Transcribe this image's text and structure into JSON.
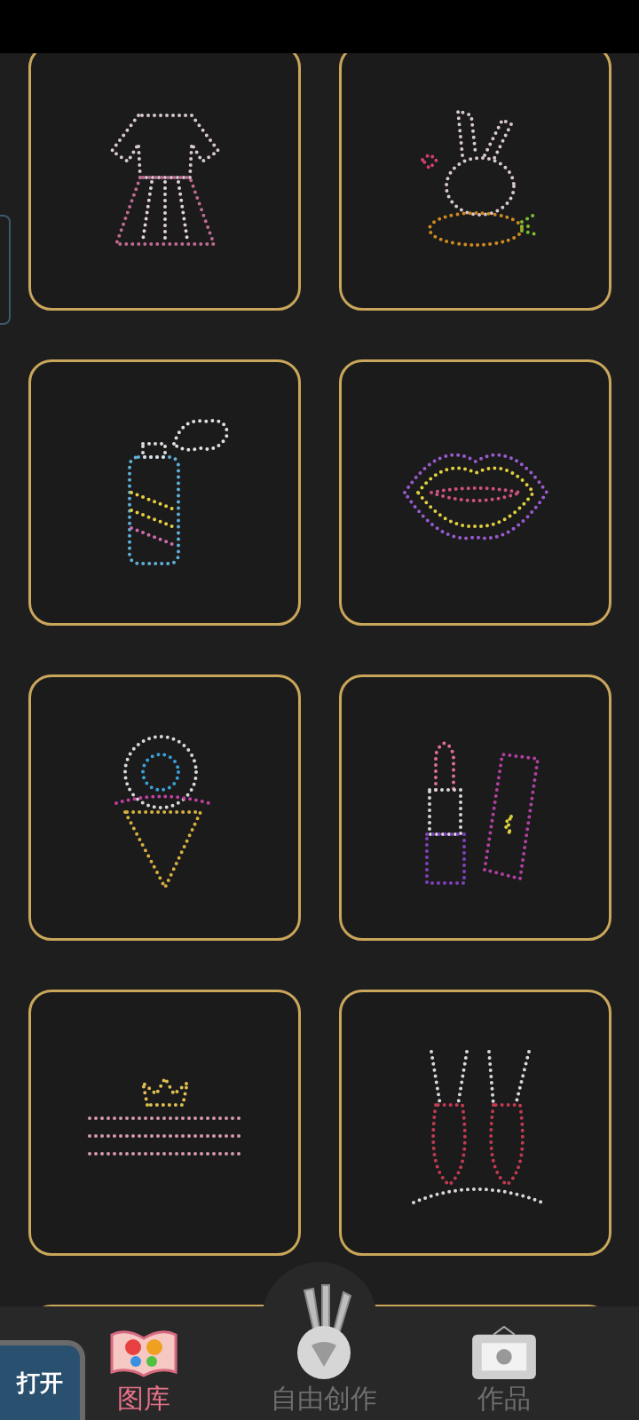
{
  "gallery": [
    {
      "kind": "dress"
    },
    {
      "kind": "rabbit"
    },
    {
      "kind": "spray"
    },
    {
      "kind": "lips"
    },
    {
      "kind": "icecream"
    },
    {
      "kind": "lipstick"
    },
    {
      "kind": "princess"
    },
    {
      "kind": "ballet"
    },
    {
      "kind": "blank"
    },
    {
      "kind": "blank"
    }
  ],
  "tabs": [
    {
      "label": "图库",
      "kind": "book",
      "selected": true
    },
    {
      "label": "自由创作",
      "kind": "brushes",
      "selected": false
    },
    {
      "label": "作品",
      "kind": "frame",
      "selected": false
    }
  ],
  "floating_app": {
    "label": "打开"
  }
}
